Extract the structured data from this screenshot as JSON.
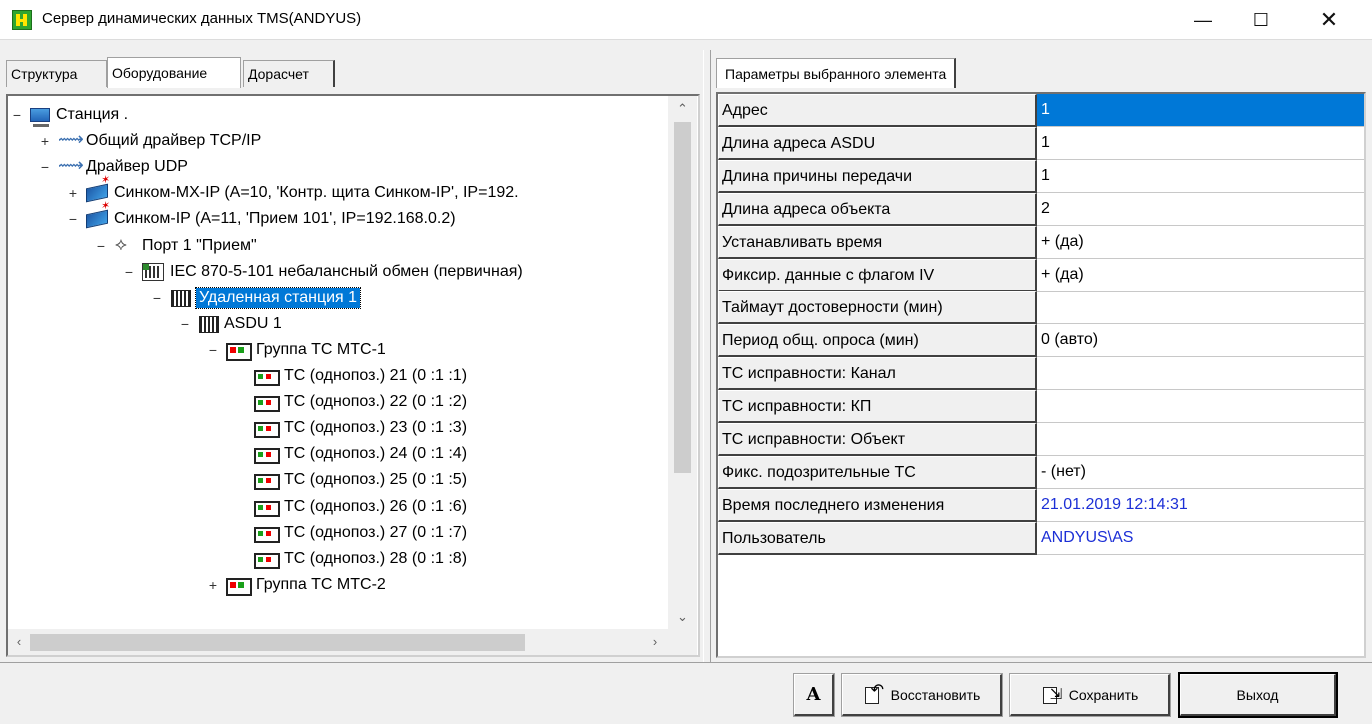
{
  "window": {
    "title": "Сервер динамических данных TMS(ANDYUS)",
    "controls": {
      "minimize": "—",
      "maximize": "☐",
      "close": "✕"
    }
  },
  "left_tabs": [
    "Структура",
    "Оборудование",
    "Дорасчет"
  ],
  "active_left_tab": "Оборудование",
  "right_tab": "Параметры выбранного элемента",
  "tree": [
    {
      "expander": "−",
      "icon": "computer-icon",
      "label": "Станция ."
    },
    {
      "expander": "+",
      "icon": "driver-icon",
      "label": "Общий драйвер TCP/IP"
    },
    {
      "expander": "−",
      "icon": "driver-icon",
      "label": "Драйвер UDP"
    },
    {
      "expander": "+",
      "icon": "device-icon",
      "label": "Синком-MX-IP  (A=10, 'Контр. щита Синком-IP', IP=192."
    },
    {
      "expander": "−",
      "icon": "device-icon",
      "label": "Синком-IP  (A=11, 'Прием 101', IP=192.168.0.2)"
    },
    {
      "expander": "−",
      "icon": "port-icon",
      "label": "Порт 1  \"Прием\""
    },
    {
      "expander": "−",
      "icon": "protocol-icon",
      "label": "IEC 870-5-101 небалансный обмен (первичная)"
    },
    {
      "expander": "−",
      "icon": "station-icon",
      "label": "Удаленная станция 1",
      "selected": true
    },
    {
      "expander": "−",
      "icon": "asdu-icon",
      "label": "ASDU 1"
    },
    {
      "expander": "−",
      "icon": "group-icon",
      "label": "Группа ТС МТС-1"
    },
    {
      "expander": "",
      "icon": "ts-icon",
      "label": "ТС (однопоз.)  21 (0 :1 :1)"
    },
    {
      "expander": "",
      "icon": "ts-icon",
      "label": "ТС (однопоз.)  22 (0 :1 :2)"
    },
    {
      "expander": "",
      "icon": "ts-icon",
      "label": "ТС (однопоз.)  23 (0 :1 :3)"
    },
    {
      "expander": "",
      "icon": "ts-icon",
      "label": "ТС (однопоз.)  24 (0 :1 :4)"
    },
    {
      "expander": "",
      "icon": "ts-icon",
      "label": "ТС (однопоз.)  25 (0 :1 :5)"
    },
    {
      "expander": "",
      "icon": "ts-icon",
      "label": "ТС (однопоз.)  26 (0 :1 :6)"
    },
    {
      "expander": "",
      "icon": "ts-icon",
      "label": "ТС (однопоз.)  27 (0 :1 :7)"
    },
    {
      "expander": "",
      "icon": "ts-icon",
      "label": "ТС (однопоз.)  28 (0 :1 :8)"
    },
    {
      "expander": "+",
      "icon": "group-icon",
      "label": "Группа ТС МТС-2"
    }
  ],
  "scroll": {
    "up": "⌃",
    "down": "⌄",
    "left": "‹",
    "right": "›"
  },
  "properties": [
    {
      "name": "Адрес",
      "value": "1",
      "selected": true
    },
    {
      "name": "Длина адреса ASDU",
      "value": "1"
    },
    {
      "name": "Длина причины передачи",
      "value": "1"
    },
    {
      "name": "Длина адреса объекта",
      "value": "2"
    },
    {
      "name": "Устанавливать время",
      "value": "+ (да)"
    },
    {
      "name": "Фиксир. данные с флагом IV",
      "value": "+ (да)"
    },
    {
      "name": "Таймаут достоверности (мин)",
      "value": ""
    },
    {
      "name": "Период общ. опроса (мин)",
      "value": "0 (авто)"
    },
    {
      "name": "ТС исправности: Канал",
      "value": ""
    },
    {
      "name": "ТС исправности: КП",
      "value": ""
    },
    {
      "name": "ТС исправности: Объект",
      "value": ""
    },
    {
      "name": "Фикс. подозрительные ТС",
      "value": "- (нет)"
    },
    {
      "name": "Время последнего изменения",
      "value": "21.01.2019 12:14:31",
      "blue": true
    },
    {
      "name": "Пользователь",
      "value": "ANDYUS\\AS",
      "blue": true
    }
  ],
  "buttons": {
    "font": "A",
    "restore": "Восстановить",
    "save": "Сохранить",
    "exit": "Выход"
  },
  "colors": {
    "selection": "#0078d7",
    "link_value": "#1c2fd6"
  }
}
